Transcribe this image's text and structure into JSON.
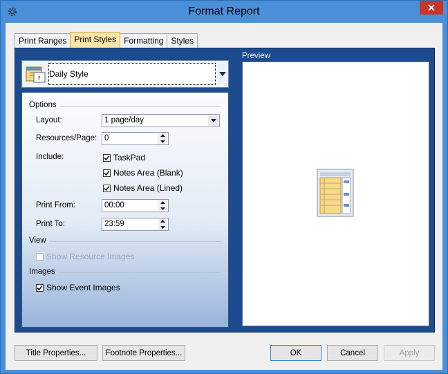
{
  "window": {
    "title": "Format Report",
    "app_icon": "gear-icon",
    "close_icon": "close-icon"
  },
  "tabs": [
    {
      "label": "Print Ranges",
      "active": false
    },
    {
      "label": "Print Styles",
      "active": true
    },
    {
      "label": "Formatting",
      "active": false
    },
    {
      "label": "Styles",
      "active": false
    }
  ],
  "style_selector": {
    "value": "Daily Style",
    "icon": "calendar-icon"
  },
  "options": {
    "group_label": "Options",
    "layout_label": "Layout:",
    "layout_value": "1 page/day",
    "resources_label": "Resources/Page:",
    "resources_value": "0",
    "include_label": "Include:",
    "include_items": [
      {
        "label": "TaskPad",
        "checked": true
      },
      {
        "label": "Notes Area (Blank)",
        "checked": true
      },
      {
        "label": "Notes Area (Lined)",
        "checked": true
      }
    ],
    "print_from_label": "Print From:",
    "print_from_value": "00:00",
    "print_to_label": "Print To:",
    "print_to_value": "23:59"
  },
  "view": {
    "group_label": "View",
    "show_resource_images": {
      "label": "Show Resource Images",
      "checked": false,
      "enabled": false
    }
  },
  "images": {
    "group_label": "Images",
    "show_event_images": {
      "label": "Show Event Images",
      "checked": true
    }
  },
  "preview": {
    "label": "Preview",
    "icon": "report-preview-icon"
  },
  "buttons": {
    "title_properties": "Title Properties...",
    "footnote_properties": "Footnote Properties...",
    "ok": "OK",
    "cancel": "Cancel",
    "apply": "Apply"
  },
  "colors": {
    "title_bar": "#4a8fd8",
    "tab_page": "#1d4b8f",
    "active_tab": "#fde7a8",
    "close_button": "#c8352b"
  }
}
